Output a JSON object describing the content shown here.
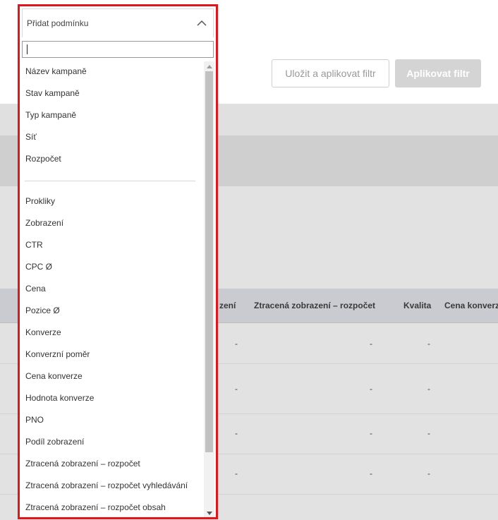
{
  "toolbar": {
    "save_apply_label": "Uložit a aplikovat filtr",
    "apply_label": "Aplikovat filtr"
  },
  "dropdown": {
    "title": "Přidat podmínku",
    "search_value": "",
    "group1": [
      "Název kampaně",
      "Stav kampaně",
      "Typ kampaně",
      "Síť",
      "Rozpočet"
    ],
    "group2": [
      "Prokliky",
      "Zobrazení",
      "CTR",
      "CPC Ø",
      "Cena",
      "Pozice Ø",
      "Konverze",
      "Konverzní poměr",
      "Cena konverze",
      "Hodnota konverze",
      "PNO",
      "Podíl zobrazení",
      "Ztracená zobrazení – rozpočet",
      "Ztracená zobrazení – rozpočet vyhledávání",
      "Ztracená zobrazení – rozpočet obsah"
    ]
  },
  "table": {
    "headers": [
      "zení",
      "Ztracená zobrazení – rozpočet",
      "Kvalita",
      "Cena konverz"
    ],
    "rows": [
      [
        "-",
        "-",
        "-"
      ],
      [
        "-",
        "-",
        "-"
      ],
      [
        "-",
        "-",
        "-"
      ],
      [
        "-",
        "-",
        "-"
      ]
    ]
  },
  "colors": {
    "highlight_border": "#e3151b",
    "apply_button_bg": "#d4d4d4"
  }
}
